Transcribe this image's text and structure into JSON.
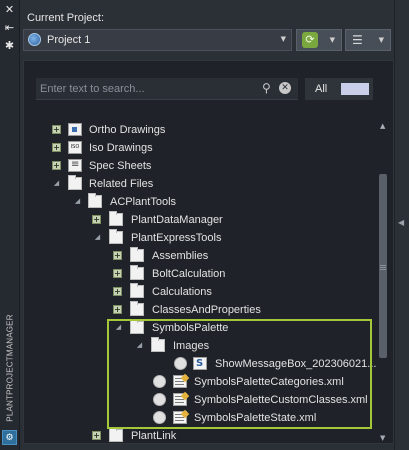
{
  "sidebar": {
    "vertical_label": "PLANTPROJECTMANAGER"
  },
  "header": {
    "title": "Current Project:",
    "project_name": "Project 1"
  },
  "search": {
    "placeholder": "Enter text to search..."
  },
  "filter": {
    "label": "All"
  },
  "tree": [
    {
      "label": "Ortho Drawings",
      "icon": "ortho-drawing-icon",
      "expander": "plus",
      "status": false
    },
    {
      "label": "Iso Drawings",
      "icon": "iso-drawing-icon",
      "expander": "plus",
      "status": false
    },
    {
      "label": "Spec Sheets",
      "icon": "spec-sheet-icon",
      "expander": "plus",
      "status": false
    },
    {
      "label": "Related Files",
      "icon": "folder-icon",
      "expander": "open",
      "status": false
    },
    {
      "label": "ACPlantTools",
      "icon": "folder-icon",
      "expander": "open",
      "status": false
    },
    {
      "label": "PlantDataManager",
      "icon": "folder-icon",
      "expander": "plus",
      "status": false
    },
    {
      "label": "PlantExpressTools",
      "icon": "folder-icon",
      "expander": "open",
      "status": false
    },
    {
      "label": "Assemblies",
      "icon": "folder-icon",
      "expander": "plus",
      "status": false
    },
    {
      "label": "BoltCalculation",
      "icon": "folder-icon",
      "expander": "plus",
      "status": false
    },
    {
      "label": "Calculations",
      "icon": "folder-icon",
      "expander": "plus",
      "status": false
    },
    {
      "label": "ClassesAndProperties",
      "icon": "folder-icon",
      "expander": "plus",
      "status": false
    },
    {
      "label": "SymbolsPalette",
      "icon": "folder-icon",
      "expander": "open",
      "status": false
    },
    {
      "label": "Images",
      "icon": "folder-icon",
      "expander": "open",
      "status": false
    },
    {
      "label": "ShowMessageBox_202306021...",
      "icon": "powershell-file-icon",
      "expander": "none",
      "status": true
    },
    {
      "label": "SymbolsPaletteCategories.xml",
      "icon": "xml-file-icon",
      "expander": "none",
      "status": true
    },
    {
      "label": "SymbolsPaletteCustomClasses.xml",
      "icon": "xml-file-icon",
      "expander": "none",
      "status": true
    },
    {
      "label": "SymbolsPaletteState.xml",
      "icon": "xml-file-icon",
      "expander": "none",
      "status": true
    },
    {
      "label": "PlantLink",
      "icon": "folder-icon",
      "expander": "plus",
      "status": false
    }
  ],
  "colors": {
    "background": "#2b2f36",
    "tree_background": "#1f2329",
    "highlight_border": "#a5c83a",
    "sync_green": "#7aa83e",
    "filter_swatch": "#c9cfe8"
  }
}
